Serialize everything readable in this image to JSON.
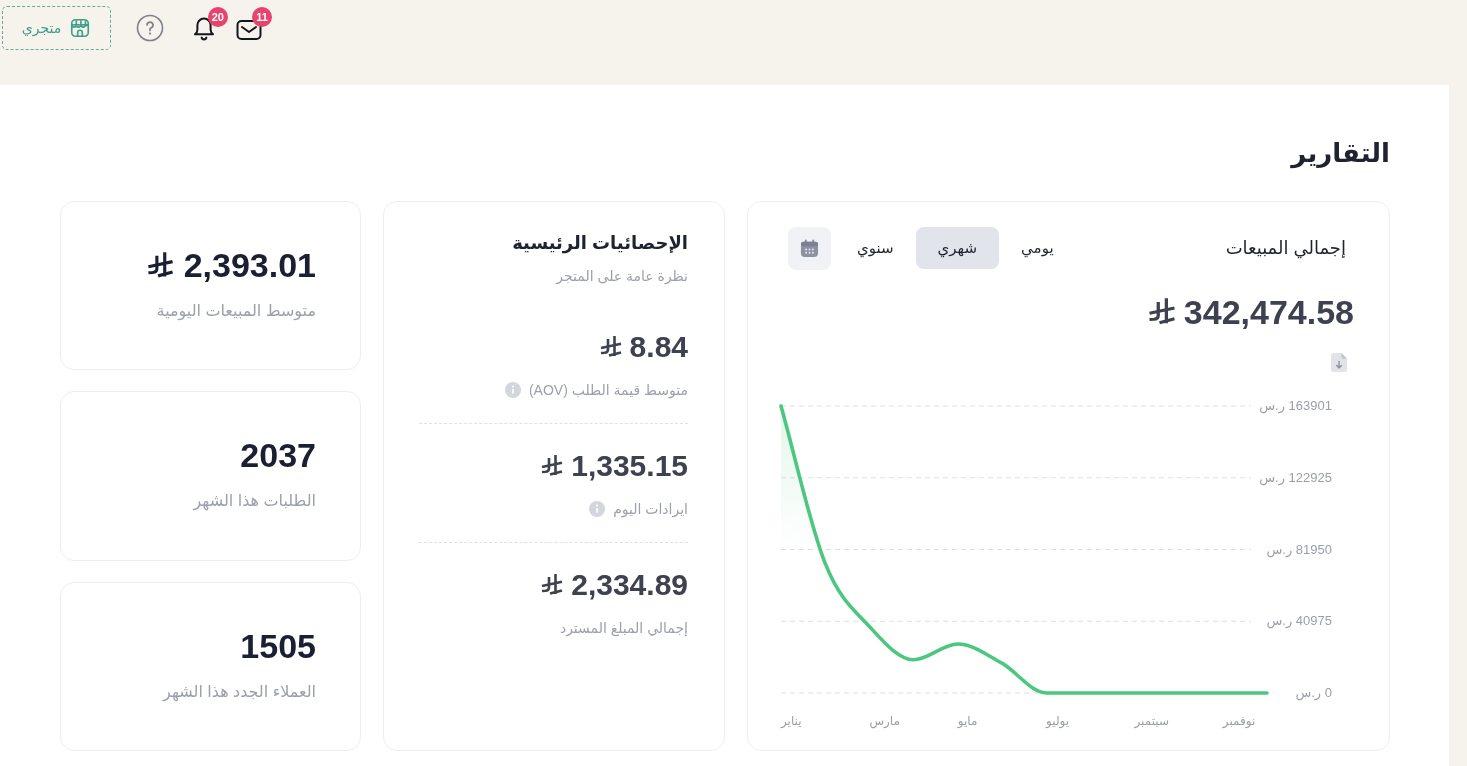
{
  "header": {
    "store_button": {
      "label": "متجري"
    },
    "notifications": {
      "count": "20"
    },
    "messages": {
      "count": "11"
    }
  },
  "page_title": "التقارير",
  "sales_card": {
    "title": "إجمالي المبيعات",
    "tabs": [
      {
        "label": "يومي",
        "selected": false
      },
      {
        "label": "شهري",
        "selected": true
      },
      {
        "label": "سنوي",
        "selected": false
      }
    ],
    "total": "342,474.58",
    "chart_data": [
      {
        "type": "area",
        "categories": [
          "يناير",
          null,
          "مارس",
          null,
          "مايو",
          null,
          "يوليو",
          null,
          "سبتمبر",
          null,
          "نوفمبر",
          null
        ],
        "values": [
          163901,
          74000,
          38000,
          19000,
          28000,
          17000,
          0,
          0,
          0,
          0,
          0,
          0
        ],
        "color": "#4cc77f",
        "ylim": [
          0,
          163901
        ],
        "yticks": [
          {
            "value": 0,
            "label": "0 ر.س"
          },
          {
            "value": 40975,
            "label": "40975 ر.س"
          },
          {
            "value": 81950,
            "label": "81950 ر.س"
          },
          {
            "value": 122925,
            "label": "122925 ر.س"
          },
          {
            "value": 163901,
            "label": "163901 ر.س"
          }
        ],
        "grid": true
      }
    ]
  },
  "key_stats": {
    "title": "الإحصائيات الرئيسية",
    "subtitle": "نظرة عامة على المتجر",
    "items": [
      {
        "value": "8.84",
        "label": "متوسط قيمة الطلب (AOV)",
        "info": true
      },
      {
        "value": "1,335.15",
        "label": "ايرادات اليوم",
        "info": true
      },
      {
        "value": "2,334.89",
        "label": "إجمالي المبلغ المسترد",
        "info": false
      }
    ]
  },
  "summary_cards": [
    {
      "kind": "amount",
      "value": "2,393.01",
      "label": "متوسط المبيعات اليومية"
    },
    {
      "kind": "count",
      "value": "2037",
      "label": "الطلبات هذا الشهر"
    },
    {
      "kind": "count",
      "value": "1505",
      "label": "العملاء الجدد هذا الشهر"
    }
  ]
}
